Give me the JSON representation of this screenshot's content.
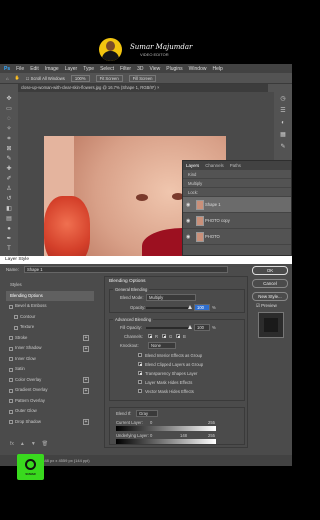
{
  "creator": {
    "name": "Sumar Majumdar",
    "handle": "VIDEO EDITOR"
  },
  "app": {
    "logo": "Ps",
    "menu": [
      "File",
      "Edit",
      "Image",
      "Layer",
      "Type",
      "Select",
      "Filter",
      "3D",
      "View",
      "Plugins",
      "Window",
      "Help"
    ],
    "options": {
      "scroll_all_windows": "Scroll All Windows",
      "zoom": "100%",
      "fit_screen": "Fit Screen",
      "fill_screen": "Fill Screen"
    },
    "document_tab": "close-up-woman-with-clear-skin-flowers.jpg @ 16.7% (Shape 1, RGB/8*) ×"
  },
  "layers_panel": {
    "tabs": [
      "Layers",
      "Channels",
      "Paths"
    ],
    "kind_label": "Kind",
    "mode_label": "Multiply",
    "lock_label": "Lock:",
    "layers": [
      {
        "name": "Shape 1"
      },
      {
        "name": "PHOTO copy"
      },
      {
        "name": "PHOTO"
      }
    ]
  },
  "layer_style": {
    "title": "Layer Style",
    "name_label": "Name:",
    "name_value": "Shape 1",
    "styles_heading": "Styles",
    "blending_options_item": "Blending Options",
    "items": [
      {
        "label": "Bevel & Emboss",
        "sub": false,
        "plus": false
      },
      {
        "label": "Contour",
        "sub": true,
        "plus": false
      },
      {
        "label": "Texture",
        "sub": true,
        "plus": false
      },
      {
        "label": "Stroke",
        "sub": false,
        "plus": true
      },
      {
        "label": "Inner Shadow",
        "sub": false,
        "plus": true
      },
      {
        "label": "Inner Glow",
        "sub": false,
        "plus": false
      },
      {
        "label": "Satin",
        "sub": false,
        "plus": false
      },
      {
        "label": "Color Overlay",
        "sub": false,
        "plus": true
      },
      {
        "label": "Gradient Overlay",
        "sub": false,
        "plus": true
      },
      {
        "label": "Pattern Overlay",
        "sub": false,
        "plus": false
      },
      {
        "label": "Outer Glow",
        "sub": false,
        "plus": false
      },
      {
        "label": "Drop Shadow",
        "sub": false,
        "plus": true
      }
    ],
    "fx_label": "fx",
    "blending": {
      "title": "Blending Options",
      "general_legend": "General Blending",
      "blend_mode_label": "Blend Mode:",
      "blend_mode_value": "Multiply",
      "opacity_label": "Opacity:",
      "opacity_value": "100",
      "opacity_pct": 100,
      "advanced_legend": "Advanced Blending",
      "fill_opacity_label": "Fill Opacity:",
      "fill_opacity_value": "100",
      "fill_opacity_pct": 100,
      "channels_label": "Channels:",
      "channel_r": "R",
      "channel_g": "G",
      "channel_b": "B",
      "knockout_label": "Knockout:",
      "knockout_value": "None",
      "checkboxes": [
        {
          "label": "Blend Interior Effects as Group",
          "checked": false
        },
        {
          "label": "Blend Clipped Layers as Group",
          "checked": true
        },
        {
          "label": "Transparency Shapes Layer",
          "checked": true
        },
        {
          "label": "Layer Mask Hides Effects",
          "checked": false
        },
        {
          "label": "Vector Mask Hides Effects",
          "checked": false
        }
      ],
      "blend_if_label": "Blend If:",
      "blend_if_value": "Gray",
      "current_layer_label": "Current Layer:",
      "current_low": "0",
      "current_high": "255",
      "underlying_layer_label": "Underlying Layer:",
      "underlying_low": "0",
      "underlying_mid": "148",
      "underlying_high": "255"
    },
    "buttons": {
      "ok": "OK",
      "cancel": "Cancel",
      "new_style": "New Style...",
      "preview": "Preview"
    },
    "status": "3648 px x 4559 px (144 ppi)"
  },
  "channel_logo": {
    "text": "SUMAR"
  },
  "colors": {
    "ps_blue": "#31a8ff",
    "panel_bg": "#535353",
    "dialog_bg": "#4b4b4b",
    "logo_green": "#39d91e",
    "avatar_yellow": "#f2c40f"
  }
}
